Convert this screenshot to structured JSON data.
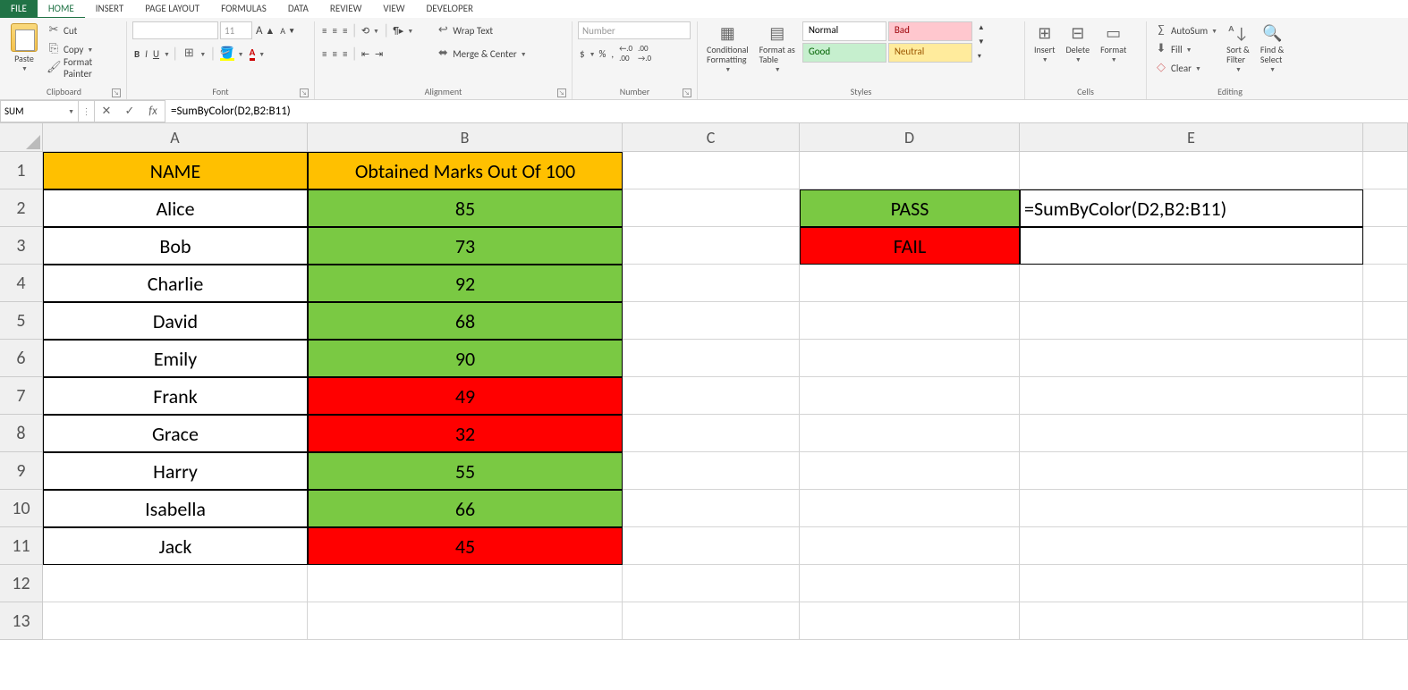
{
  "tabs": {
    "file": "FILE",
    "home": "HOME",
    "insert": "INSERT",
    "page": "PAGE LAYOUT",
    "formulas": "FORMULAS",
    "data": "DATA",
    "review": "REVIEW",
    "view": "VIEW",
    "developer": "DEVELOPER"
  },
  "clipboard": {
    "paste": "Paste",
    "cut": "Cut",
    "copy": "Copy",
    "painter": "Format Painter",
    "label": "Clipboard"
  },
  "font": {
    "size": "11",
    "bold": "B",
    "italic": "I",
    "underline": "U",
    "label": "Font"
  },
  "alignment": {
    "wrap": "Wrap Text",
    "merge": "Merge & Center",
    "label": "Alignment"
  },
  "number": {
    "dd": "Number",
    "dollar": "$",
    "pct": "%",
    "comma": ",",
    "dec1": ".0←.00",
    "dec2": ".00→.0",
    "label": "Number"
  },
  "styles": {
    "cond": "Conditional\nFormatting",
    "fmt": "Format as\nTable",
    "normal": "Normal",
    "bad": "Bad",
    "good": "Good",
    "neutral": "Neutral",
    "label": "Styles"
  },
  "cells": {
    "insert": "Insert",
    "delete": "Delete",
    "format": "Format",
    "label": "Cells"
  },
  "editing": {
    "autosum": "AutoSum",
    "fill": "Fill",
    "clear": "Clear",
    "sort": "Sort &\nFilter",
    "find": "Find &\nSelect",
    "label": "Editing"
  },
  "namebox": "SUM",
  "formula": "=SumByColor(D2,B2:B11)",
  "cols": [
    "A",
    "B",
    "C",
    "D",
    "E"
  ],
  "headers": {
    "a": "NAME",
    "b": "Obtained Marks Out Of 100"
  },
  "rows": [
    {
      "name": "Alice",
      "marks": "85",
      "color": "green"
    },
    {
      "name": "Bob",
      "marks": "73",
      "color": "green"
    },
    {
      "name": "Charlie",
      "marks": "92",
      "color": "green"
    },
    {
      "name": "David",
      "marks": "68",
      "color": "green"
    },
    {
      "name": "Emily",
      "marks": "90",
      "color": "green"
    },
    {
      "name": "Frank",
      "marks": "49",
      "color": "red"
    },
    {
      "name": "Grace",
      "marks": "32",
      "color": "red"
    },
    {
      "name": "Harry",
      "marks": "55",
      "color": "green"
    },
    {
      "name": "Isabella",
      "marks": "66",
      "color": "green"
    },
    {
      "name": "Jack",
      "marks": "45",
      "color": "red"
    }
  ],
  "side": {
    "pass": "PASS",
    "fail": "FAIL",
    "formula": "=SumByColor(D2,B2:B11)"
  }
}
